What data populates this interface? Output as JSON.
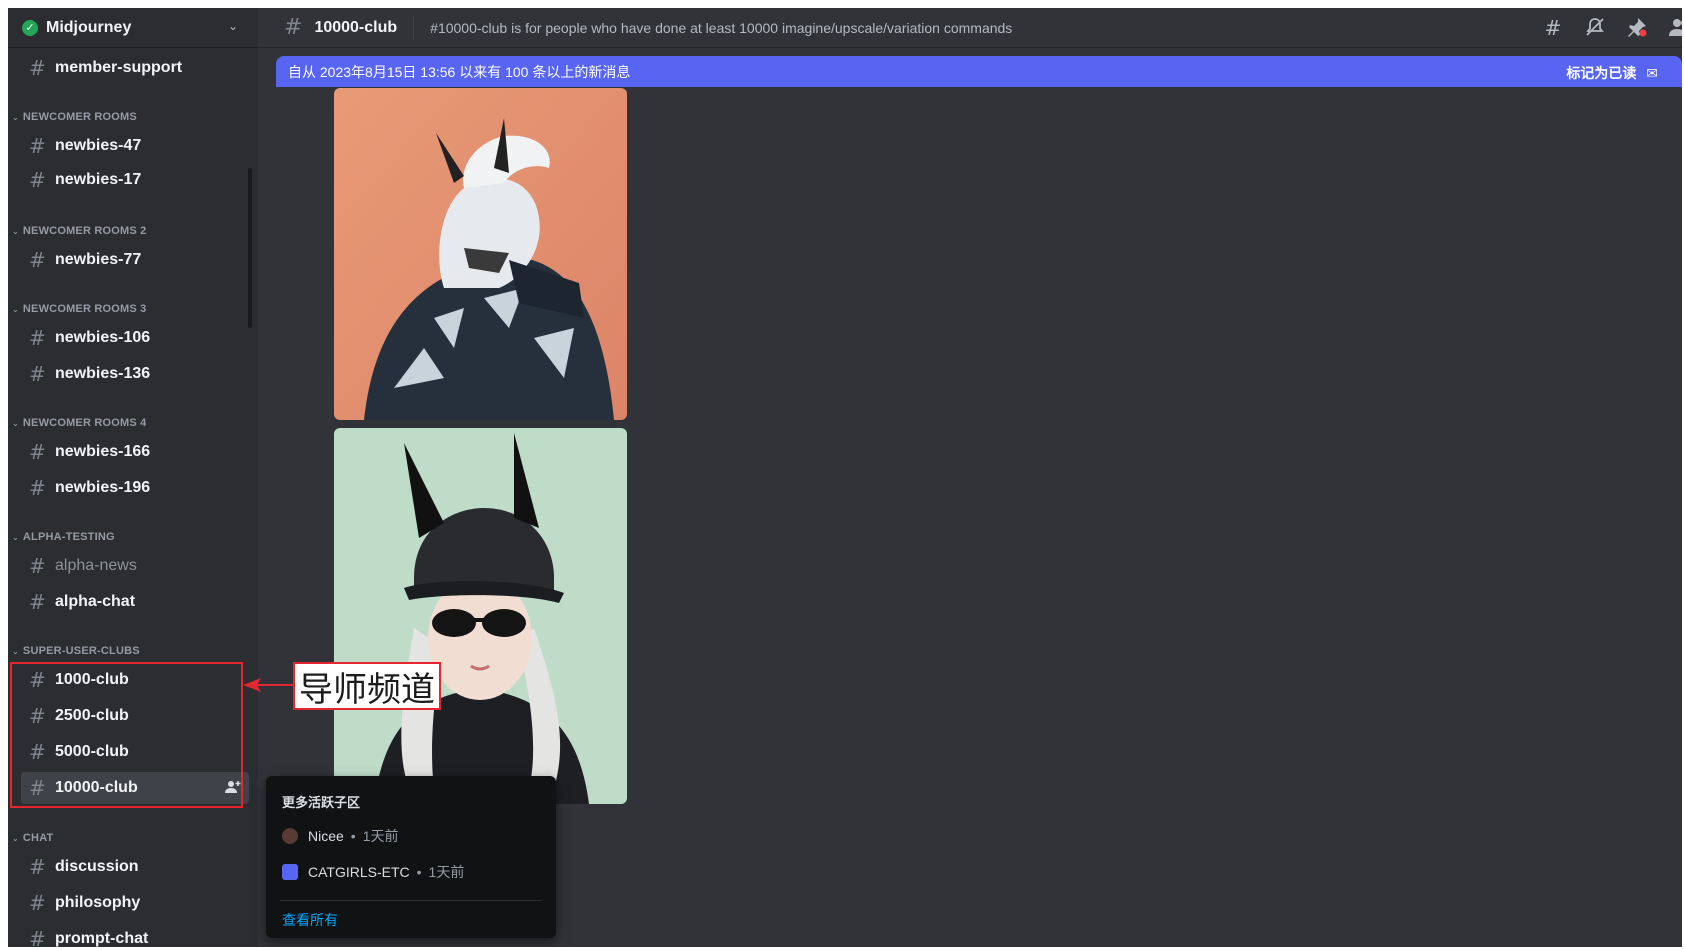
{
  "server": {
    "name": "Midjourney"
  },
  "sidebar": {
    "top_channel": "member-support",
    "categories": [
      {
        "name": "NEWCOMER ROOMS",
        "channels": [
          "newbies-47",
          "newbies-17"
        ]
      },
      {
        "name": "NEWCOMER ROOMS 2",
        "channels": [
          "newbies-77"
        ]
      },
      {
        "name": "NEWCOMER ROOMS 3",
        "channels": [
          "newbies-106",
          "newbies-136"
        ]
      },
      {
        "name": "NEWCOMER ROOMS 4",
        "channels": [
          "newbies-166",
          "newbies-196"
        ]
      },
      {
        "name": "ALPHA-TESTING",
        "channels": [
          "alpha-news",
          "alpha-chat"
        ]
      },
      {
        "name": "SUPER-USER-CLUBS",
        "channels": [
          "1000-club",
          "2500-club",
          "5000-club",
          "10000-club"
        ]
      },
      {
        "name": "CHAT",
        "channels": [
          "discussion",
          "philosophy",
          "prompt-chat"
        ]
      }
    ]
  },
  "header": {
    "channel": "10000-club",
    "topic": "#10000-club is for people who have done at least 10000 imagine/upscale/variation commands"
  },
  "banner": {
    "text": "自从 2023年8月15日 13:56 以来有 100 条以上的新消息",
    "mark_read": "标记为已读"
  },
  "annotation": {
    "label": "导师频道"
  },
  "popup": {
    "title": "更多活跃子区",
    "threads": [
      {
        "name": "Nicee",
        "time": "1天前"
      },
      {
        "name": "CATGIRLS-ETC",
        "time": "1天前"
      }
    ],
    "view_all": "查看所有"
  },
  "colors": {
    "accent": "#5865f2",
    "annotation_red": "#e3262f",
    "online_green": "#23a55a"
  }
}
